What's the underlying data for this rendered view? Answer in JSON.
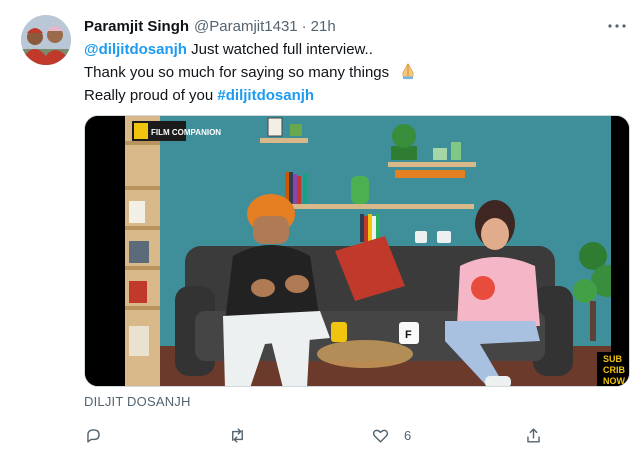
{
  "tweet": {
    "author": {
      "name": "Paramjit Singh",
      "handle": "@Paramjit1431",
      "separator": "·",
      "time": "21h",
      "avatar_icon": "profile-photo"
    },
    "more_icon": "more-options-icon",
    "text": {
      "mention": "@diljitdosanjh",
      "line1_rest": " Just watched full interview..",
      "line2": "Thank you so much for saying so many things",
      "line2_emoji": "folded-hands-emoji",
      "line3": "Really proud of you ",
      "hashtag": "#diljitdosanjh"
    },
    "media": {
      "watermark": "FILM COMPANION",
      "corner_badge_lines": [
        "SUB",
        "CRIB",
        "NOW"
      ],
      "mug_letter": "F"
    },
    "byline": "DILJIT DOSANJH",
    "actions": {
      "reply_icon": "reply-icon",
      "retweet_icon": "retweet-icon",
      "like_icon": "like-icon",
      "like_count": "6",
      "share_icon": "share-icon"
    }
  },
  "colors": {
    "link": "#1d9bf0",
    "secondary_text": "#536471",
    "wall_teal": "#3f8f9b"
  }
}
